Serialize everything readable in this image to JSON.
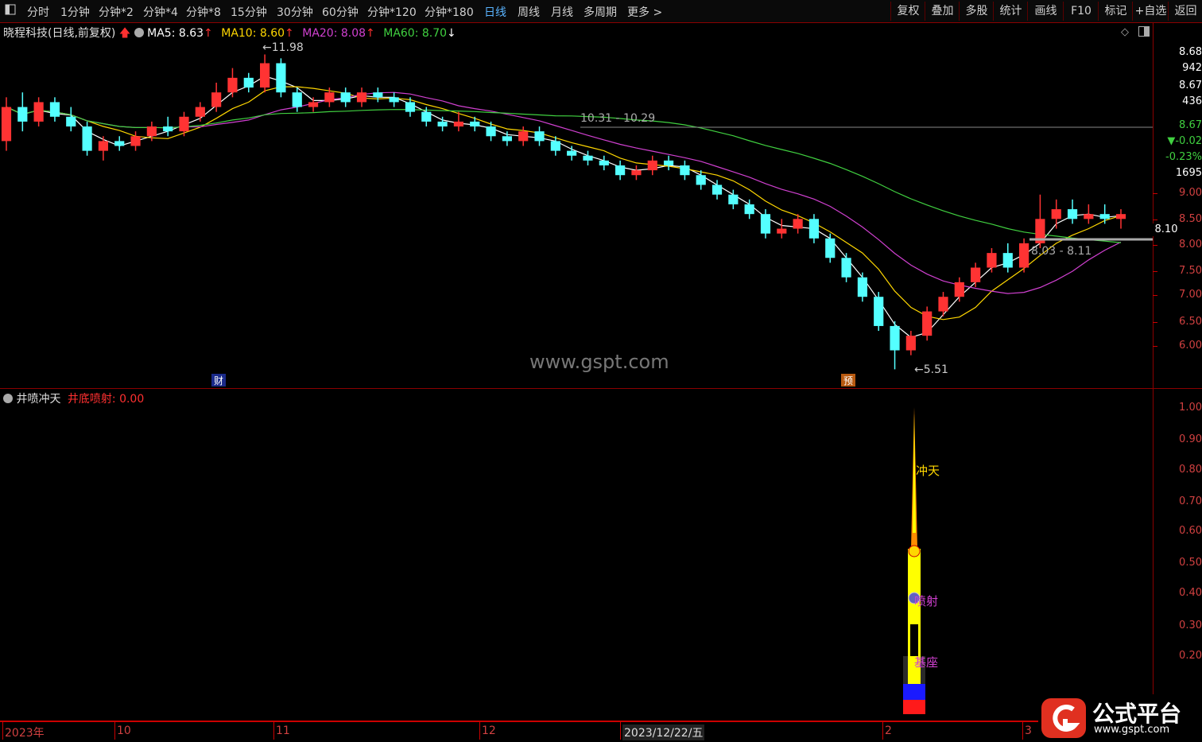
{
  "toolbar": {
    "menu_icon": "panel-icon",
    "periods": [
      "分时",
      "1分钟",
      "分钟*2",
      "分钟*4",
      "分钟*8",
      "15分钟",
      "30分钟",
      "60分钟",
      "分钟*120",
      "分钟*180",
      "日线",
      "周线",
      "月线",
      "多周期",
      "更多 >"
    ],
    "active_period": "日线",
    "right_buttons": [
      "复权",
      "叠加",
      "多股",
      "统计",
      "画线",
      "F10",
      "标记",
      "+自选",
      "返回"
    ]
  },
  "info": {
    "stock_name": "晓程科技(日线,前复权)",
    "ma5": "MA5: 8.63",
    "ma10": "MA10: 8.60",
    "ma20": "MA20: 8.08",
    "ma60": "MA60: 8.70",
    "ma5_color": "#ffffff",
    "ma10_color": "#ffd700",
    "ma20_color": "#d040d0",
    "ma60_color": "#40d040"
  },
  "price_panel": {
    "high_label": "11.98",
    "low_label": "5.51",
    "range_label_1": "10.31 - 10.29",
    "range_label_2": "8.03 - 8.11",
    "current_price_tag": "8.10",
    "marker_cai": "财",
    "marker_yu": "预",
    "watermark": "www.gspt.com",
    "axis_right": [
      "9.00",
      "8.50",
      "8.00",
      "7.50",
      "7.00",
      "6.50",
      "6.00"
    ],
    "side_values": [
      "8.68",
      "942",
      "8.67",
      "436",
      "8.67",
      "▼-0.02",
      "-0.23%",
      "1695"
    ]
  },
  "indicator": {
    "title": "井喷冲天",
    "value_label": "井底喷射: 0.00",
    "axis_right": [
      "1.00",
      "0.90",
      "0.80",
      "0.70",
      "0.60",
      "0.50",
      "0.40",
      "0.30",
      "0.20"
    ],
    "label_chongtian": "冲天",
    "label_penshe": "喷射",
    "label_jizuo": "基座"
  },
  "date_axis": {
    "labels": [
      "2023年",
      "10",
      "11",
      "12",
      "2023/12/22/五",
      "2",
      "3"
    ]
  },
  "logo": {
    "text": "公式平台",
    "url_text": "www.gspt.com"
  },
  "chart_data": {
    "type": "candlestick",
    "ylim": [
      5.5,
      12.2
    ],
    "candles_approx": [
      [
        10.2,
        10.9,
        10.0,
        11.1
      ],
      [
        10.9,
        10.6,
        10.4,
        11.2
      ],
      [
        10.6,
        11.0,
        10.5,
        11.1
      ],
      [
        11.0,
        10.7,
        10.6,
        11.1
      ],
      [
        10.7,
        10.5,
        10.4,
        10.9
      ],
      [
        10.5,
        10.0,
        9.9,
        10.6
      ],
      [
        10.0,
        10.2,
        9.8,
        10.3
      ],
      [
        10.2,
        10.1,
        10.0,
        10.3
      ],
      [
        10.1,
        10.3,
        10.0,
        10.4
      ],
      [
        10.3,
        10.5,
        10.2,
        10.6
      ],
      [
        10.5,
        10.4,
        10.3,
        10.7
      ],
      [
        10.4,
        10.7,
        10.3,
        10.8
      ],
      [
        10.7,
        10.9,
        10.6,
        11.0
      ],
      [
        10.9,
        11.2,
        10.8,
        11.4
      ],
      [
        11.2,
        11.5,
        11.1,
        11.7
      ],
      [
        11.5,
        11.3,
        11.2,
        11.6
      ],
      [
        11.3,
        11.8,
        11.2,
        11.98
      ],
      [
        11.8,
        11.2,
        11.1,
        11.9
      ],
      [
        11.2,
        10.9,
        10.8,
        11.3
      ],
      [
        10.9,
        11.0,
        10.8,
        11.1
      ],
      [
        11.0,
        11.2,
        10.9,
        11.3
      ],
      [
        11.2,
        11.0,
        10.9,
        11.3
      ],
      [
        11.0,
        11.2,
        10.9,
        11.3
      ],
      [
        11.2,
        11.1,
        11.0,
        11.3
      ],
      [
        11.1,
        11.0,
        10.9,
        11.2
      ],
      [
        11.0,
        10.8,
        10.7,
        11.1
      ],
      [
        10.8,
        10.6,
        10.5,
        10.9
      ],
      [
        10.6,
        10.5,
        10.4,
        10.7
      ],
      [
        10.5,
        10.6,
        10.4,
        10.8
      ],
      [
        10.6,
        10.5,
        10.4,
        10.7
      ],
      [
        10.5,
        10.3,
        10.2,
        10.6
      ],
      [
        10.3,
        10.2,
        10.1,
        10.4
      ],
      [
        10.2,
        10.4,
        10.1,
        10.5
      ],
      [
        10.4,
        10.2,
        10.1,
        10.5
      ],
      [
        10.2,
        10.0,
        9.9,
        10.3
      ],
      [
        10.0,
        9.9,
        9.8,
        10.1
      ],
      [
        9.9,
        9.8,
        9.7,
        10.0
      ],
      [
        9.8,
        9.7,
        9.6,
        9.9
      ],
      [
        9.7,
        9.5,
        9.4,
        9.8
      ],
      [
        9.5,
        9.6,
        9.4,
        9.7
      ],
      [
        9.6,
        9.8,
        9.5,
        9.9
      ],
      [
        9.8,
        9.7,
        9.6,
        9.9
      ],
      [
        9.7,
        9.5,
        9.4,
        9.8
      ],
      [
        9.5,
        9.3,
        9.2,
        9.6
      ],
      [
        9.3,
        9.1,
        9.0,
        9.4
      ],
      [
        9.1,
        8.9,
        8.8,
        9.2
      ],
      [
        8.9,
        8.7,
        8.6,
        9.0
      ],
      [
        8.7,
        8.3,
        8.2,
        8.8
      ],
      [
        8.3,
        8.4,
        8.2,
        8.6
      ],
      [
        8.4,
        8.6,
        8.3,
        8.7
      ],
      [
        8.6,
        8.2,
        8.1,
        8.7
      ],
      [
        8.2,
        7.8,
        7.7,
        8.3
      ],
      [
        7.8,
        7.4,
        7.3,
        7.9
      ],
      [
        7.4,
        7.0,
        6.9,
        7.5
      ],
      [
        7.0,
        6.4,
        6.3,
        7.1
      ],
      [
        6.4,
        5.9,
        5.51,
        6.5
      ],
      [
        5.9,
        6.2,
        5.8,
        6.3
      ],
      [
        6.2,
        6.7,
        6.1,
        6.8
      ],
      [
        6.7,
        7.0,
        6.6,
        7.1
      ],
      [
        7.0,
        7.3,
        6.9,
        7.4
      ],
      [
        7.3,
        7.6,
        7.2,
        7.7
      ],
      [
        7.6,
        7.9,
        7.5,
        8.0
      ],
      [
        7.9,
        7.6,
        7.5,
        8.1
      ],
      [
        7.6,
        8.1,
        7.5,
        8.2
      ],
      [
        8.1,
        8.6,
        8.0,
        9.1
      ],
      [
        8.6,
        8.8,
        8.4,
        9.0
      ],
      [
        8.8,
        8.6,
        8.5,
        9.0
      ],
      [
        8.6,
        8.7,
        8.5,
        8.9
      ],
      [
        8.7,
        8.6,
        8.5,
        8.9
      ],
      [
        8.6,
        8.7,
        8.4,
        8.8
      ]
    ],
    "indicator_series": {
      "name": "井底喷射",
      "values": [
        0.0
      ]
    }
  }
}
